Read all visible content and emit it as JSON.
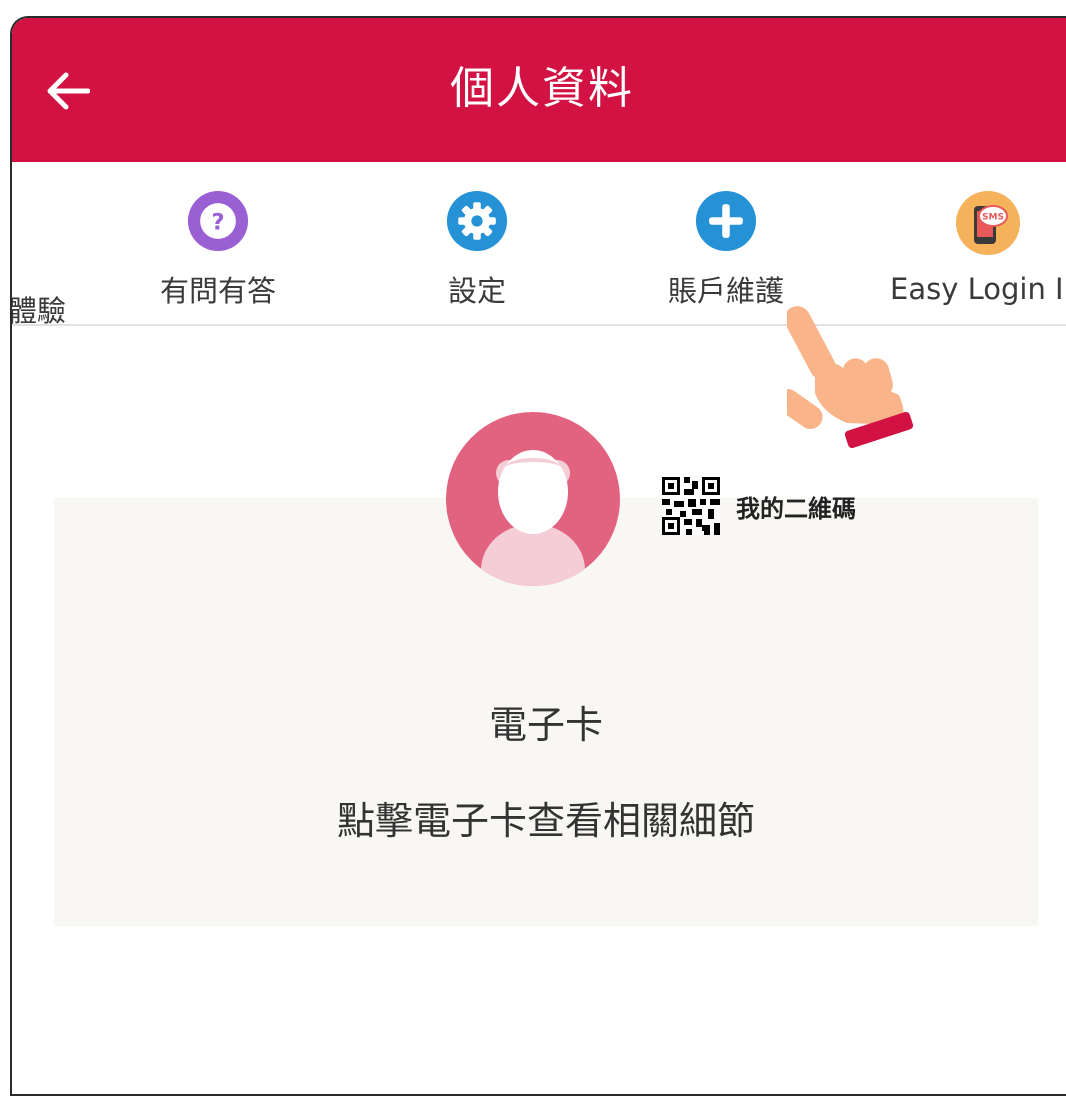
{
  "header": {
    "title": "個人資料",
    "back_icon": "arrow-left-icon",
    "color": "#d21242"
  },
  "tabs": [
    {
      "label": "體驗",
      "icon": "none"
    },
    {
      "label": "有問有答",
      "icon": "question-icon",
      "color": "#9b5fd4"
    },
    {
      "label": "設定",
      "icon": "gear-icon",
      "color": "#2592d6"
    },
    {
      "label": "賬戶維護",
      "icon": "plus-icon",
      "color": "#2592d6"
    },
    {
      "label": "Easy Login ID",
      "icon": "sms-phone-icon",
      "color": "#f5b25a"
    }
  ],
  "qr": {
    "label": "我的二維碼",
    "icon": "qr-code-icon"
  },
  "ecard": {
    "title": "電子卡",
    "subtitle": "點擊電子卡查看相關細節",
    "background": "#f8f7f3"
  },
  "avatar": {
    "icon": "user-avatar-icon",
    "color": "#e2637f"
  }
}
